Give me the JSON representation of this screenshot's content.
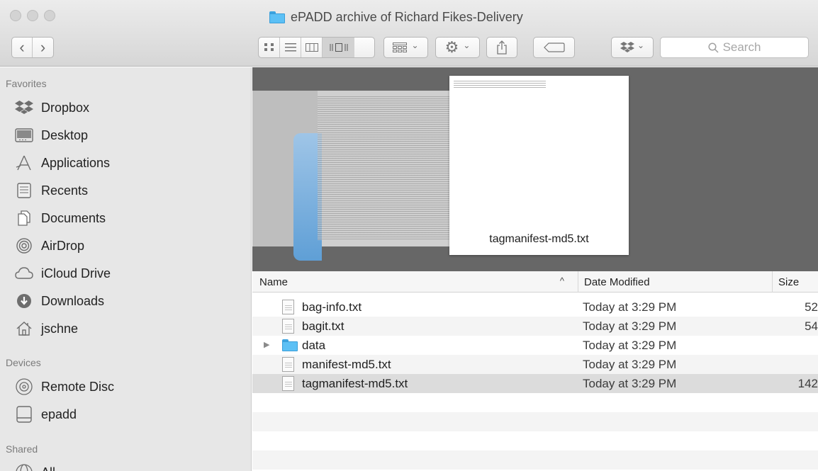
{
  "window": {
    "title": "ePADD archive of Richard Fikes-Delivery",
    "title_icon": "folder-icon"
  },
  "toolbar": {
    "back_label": "‹",
    "forward_label": "›",
    "view_modes": [
      "icon-view",
      "list-view",
      "column-view",
      "cover-flow-view"
    ],
    "arrange_icon": "grid-icon",
    "action_icon": "gear-icon",
    "share_icon": "share-icon",
    "tag_icon": "tag-icon",
    "dropbox_icon": "dropbox-icon",
    "search_placeholder": "Search",
    "chevron": "⌄"
  },
  "sidebar": {
    "favorites_heading": "Favorites",
    "favorites": [
      {
        "label": "Dropbox",
        "icon": "dropbox-icon"
      },
      {
        "label": "Desktop",
        "icon": "desktop-icon"
      },
      {
        "label": "Applications",
        "icon": "applications-icon"
      },
      {
        "label": "Recents",
        "icon": "recents-icon"
      },
      {
        "label": "Documents",
        "icon": "documents-icon"
      },
      {
        "label": "AirDrop",
        "icon": "airdrop-icon"
      },
      {
        "label": "iCloud Drive",
        "icon": "cloud-icon"
      },
      {
        "label": "Downloads",
        "icon": "downloads-icon"
      },
      {
        "label": "jschne",
        "icon": "home-icon"
      }
    ],
    "devices_heading": "Devices",
    "devices": [
      {
        "label": "Remote Disc",
        "icon": "disc-icon"
      },
      {
        "label": "epadd",
        "icon": "drive-icon"
      }
    ],
    "shared_heading": "Shared",
    "shared": [
      {
        "label": "All",
        "icon": "network-icon"
      }
    ]
  },
  "preview": {
    "filename": "tagmanifest-md5.txt"
  },
  "list": {
    "columns": {
      "name": "Name",
      "sort_indicator": "^",
      "date": "Date Modified",
      "size": "Size"
    },
    "rows": [
      {
        "name": "bag-info.txt",
        "date": "Today at 3:29 PM",
        "size": "52",
        "kind": "file"
      },
      {
        "name": "bagit.txt",
        "date": "Today at 3:29 PM",
        "size": "54",
        "kind": "file"
      },
      {
        "name": "data",
        "date": "Today at 3:29 PM",
        "size": "",
        "kind": "folder"
      },
      {
        "name": "manifest-md5.txt",
        "date": "Today at 3:29 PM",
        "size": "",
        "kind": "file"
      },
      {
        "name": "tagmanifest-md5.txt",
        "date": "Today at 3:29 PM",
        "size": "142",
        "kind": "file",
        "selected": true
      }
    ]
  }
}
